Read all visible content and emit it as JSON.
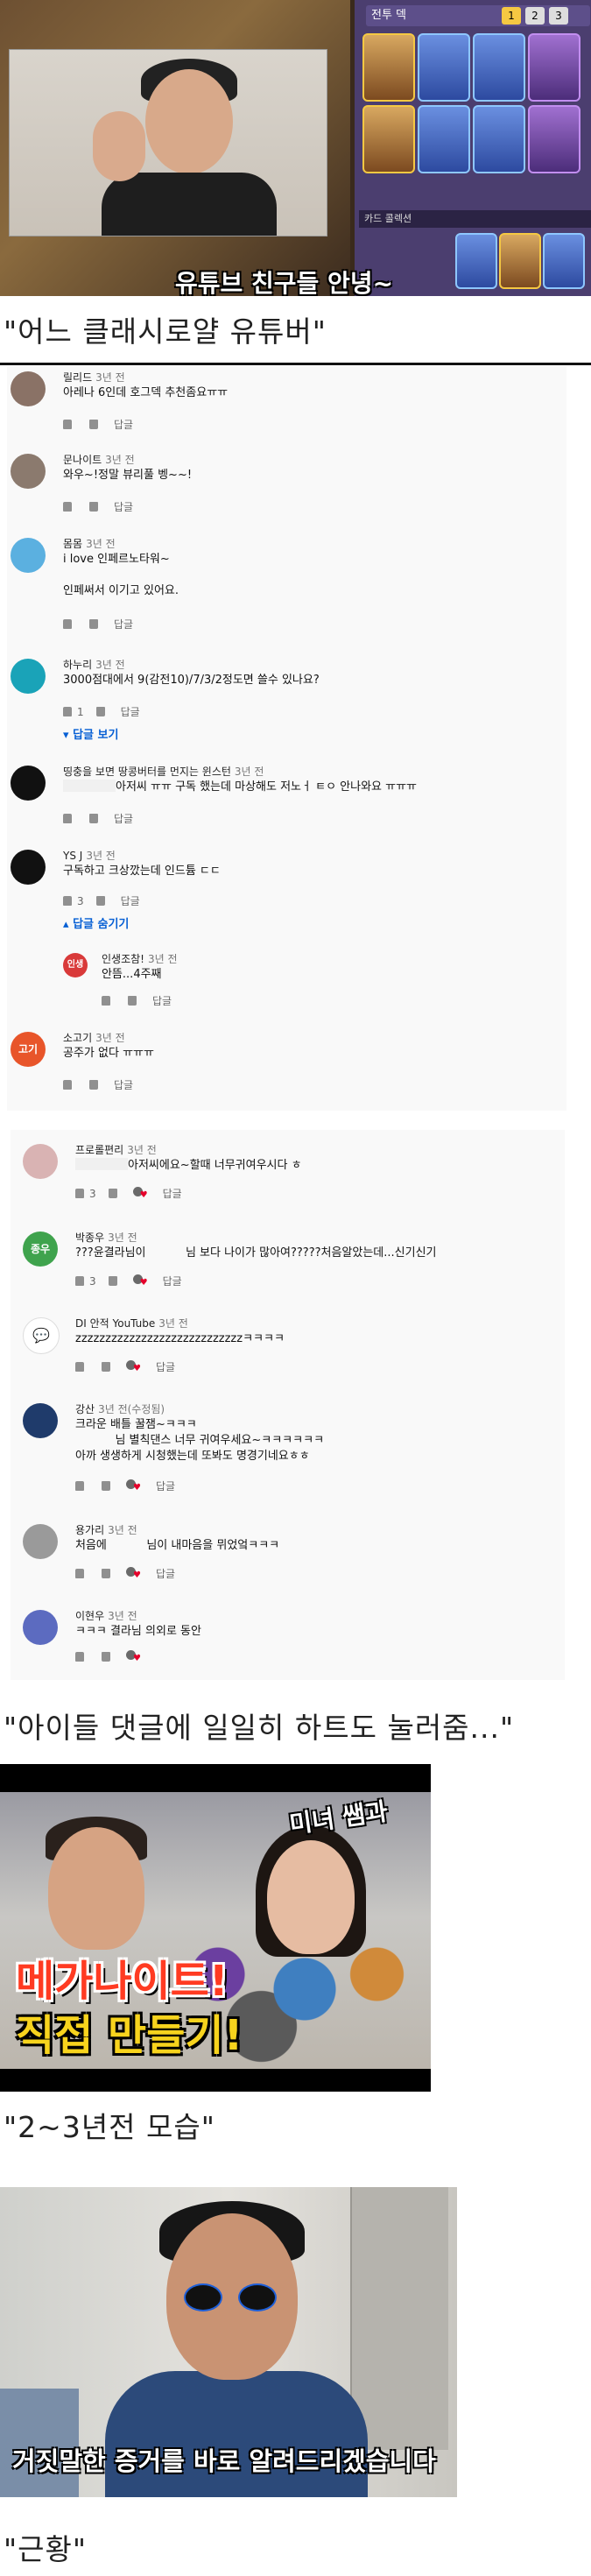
{
  "image1": {
    "deck_title": "전투 덱",
    "deck_tabs": [
      "1",
      "2",
      "3"
    ],
    "collection_label": "카드 콜렉션",
    "subtitle": "유튜브 친구들 안녕~"
  },
  "caption1": "\"어느 클래시로얄 유튜버\"",
  "comments_a": [
    {
      "avatar_color": "#8a7266",
      "avatar_text": "",
      "author": "릴리드",
      "time": "3년 전",
      "text": "아레나 6인데 호그덱 추천좀요ㅠㅠ",
      "likes": "",
      "reply": "답글"
    },
    {
      "avatar_color": "#8b7a6e",
      "avatar_text": "",
      "author": "문나이트",
      "time": "3년 전",
      "text": "와우~!정말 뷰리풀 벵~~!",
      "likes": "",
      "reply": "답글"
    },
    {
      "avatar_color": "#5bb0e0",
      "avatar_text": "",
      "author": "몸몸",
      "time": "3년 전",
      "text": "i love 인페르노타워~\n\n인페써서 이기고 있어요.",
      "likes": "",
      "reply": "답글"
    },
    {
      "avatar_color": "#1aa3b8",
      "avatar_text": "",
      "author": "하누리",
      "time": "3년 전",
      "text": "3000점대에서 9(감전10)/7/3/2정도면 쓸수 있나요?",
      "likes": "1",
      "reply": "답글",
      "view_replies": "답글 보기"
    },
    {
      "avatar_color": "#111111",
      "avatar_text": "",
      "author": "띵충을 보면 땅콩버터를 먼지는 윈스턴",
      "time": "3년 전",
      "text": "아저씨 ㅠㅠ 구독 했는데 마상해도 저노ㅓ ㅌㅇ 안나와요 ㅠㅠㅠ",
      "blur_prefix": true,
      "likes": "",
      "reply": "답글"
    },
    {
      "avatar_color": "#111111",
      "avatar_text": "",
      "author": "YS J",
      "time": "3년 전",
      "text": "구독하고 크상깠는데 인드튬 ㄷㄷ",
      "likes": "3",
      "reply": "답글",
      "hide_replies": "답글 숨기기"
    },
    {
      "avatar_color": "#d93a3a",
      "avatar_text": "인생",
      "author": "인생조참!",
      "time": "3년 전",
      "text": "안뜸...4주째",
      "likes": "",
      "reply": "답글",
      "nested": true
    },
    {
      "avatar_color": "#e8552a",
      "avatar_text": "고기",
      "author": "소고기",
      "time": "3년 전",
      "text": "공주가 없다 ㅠㅠㅠ",
      "likes": "",
      "reply": "답글"
    }
  ],
  "comments_b": [
    {
      "avatar_color": "#caa",
      "avatar_text": "",
      "author": "프로롤편리",
      "time": "3년 전",
      "text": "아저씨에요~할때 너무귀여우시다 ㅎ",
      "blur_prefix": true,
      "likes": "3",
      "reply": "답글"
    },
    {
      "avatar_color": "#3fa34d",
      "avatar_text": "종우",
      "author": "박종우",
      "time": "3년 전",
      "text": "???윤결라님이           님 보다 나이가 많아여?????처음알았는데...신기신기",
      "likes": "3",
      "reply": "답글"
    },
    {
      "avatar_color": "#ffffff",
      "avatar_text": "",
      "author": "DI 안적 YouTube",
      "time": "3년 전",
      "text": "zzzzzzzzzzzzzzzzzzzzzzzzzzzzㅋㅋㅋㅋ",
      "likes": "",
      "reply": "답글"
    },
    {
      "avatar_color": "#1f3b6b",
      "avatar_text": "",
      "author": "강산",
      "time": "3년 전(수정됨)",
      "text": "크라운 배틀 꿀잼~ㅋㅋㅋ\n           님 별칙댄스 너무 귀여우세요~ㅋㅋㅋㅋㅋㅋ\n아까 생생하게 시청했는데 또봐도 명경기네요ㅎㅎ",
      "likes": "",
      "reply": "답글"
    },
    {
      "avatar_color": "#999999",
      "avatar_text": "",
      "author": "용가리",
      "time": "3년 전",
      "text": "처음에           님이 내마음을 뮈었엌ㅋㅋㅋ",
      "likes": "",
      "reply": "답글"
    },
    {
      "avatar_color": "#5c6bc0",
      "avatar_text": "",
      "author": "이현우",
      "time": "3년 전",
      "text": "ㅋㅋㅋ 결라님 의외로 동안",
      "likes": "",
      "reply": ""
    }
  ],
  "caption2": "\"아이들 댓글에 일일히 하트도 눌러줌...\"",
  "image2": {
    "title_line1": "메가나이트!",
    "title_line2": "직접 만들기!",
    "tag": "미녀 쌤과"
  },
  "caption3": "\"2~3년전 모습\"",
  "image3": {
    "subtitle": "거짓말한 증거를 바로 알려드리겠습니다"
  },
  "caption4": "\"근황\"",
  "colors": {
    "accent_link": "#065fd4",
    "heart": "#e5002b",
    "caption_text": "#222222"
  }
}
